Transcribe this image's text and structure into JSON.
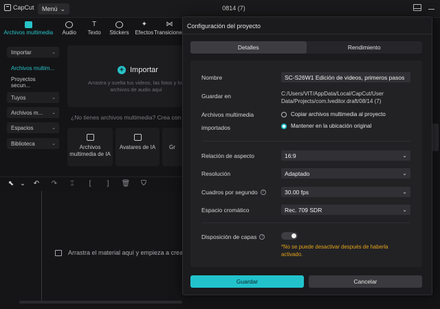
{
  "app": {
    "logo": "CapCut",
    "menu": "Menú",
    "project": "0814 (7)"
  },
  "toolbar": {
    "tabs": [
      {
        "label": "Archivos multimedia",
        "icon": "media-icon"
      },
      {
        "label": "Audio",
        "icon": "audio-icon"
      },
      {
        "label": "Texto",
        "icon": "text-icon"
      },
      {
        "label": "Stickers",
        "icon": "sticker-icon"
      },
      {
        "label": "Efectos",
        "icon": "effects-icon"
      },
      {
        "label": "Transiciones",
        "icon": "transitions-icon"
      }
    ]
  },
  "sidebar": {
    "items": [
      {
        "label": "Importar"
      },
      {
        "label": "Archivos multim..."
      },
      {
        "label": "Proyectos secun..."
      },
      {
        "label": "Tuyos"
      },
      {
        "label": "Archivos m..."
      },
      {
        "label": "Espacios"
      },
      {
        "label": "Biblioteca"
      }
    ]
  },
  "media": {
    "import_label": "Importar",
    "import_hint": "Arrastra y suelta tus videos, las fotos y los archivos de audio aquí",
    "no_media": "¿No tienes archivos multimedia? Crea con",
    "cards": [
      {
        "label": "Archivos multimedia de IA"
      },
      {
        "label": "Avatares de IA"
      },
      {
        "label": "Gr"
      }
    ]
  },
  "timeline": {
    "drop_hint": "Arrastra el material aquí y empieza a crear"
  },
  "dialog": {
    "title": "Configuración del proyecto",
    "tabs": [
      {
        "label": "Detalles",
        "active": true
      },
      {
        "label": "Rendimiento",
        "active": false
      }
    ],
    "name_label": "Nombre",
    "name_value": "SC-S26W1 Edición de videos, primeros pasos",
    "save_label": "Guardar en",
    "save_path": "C:/Users/VIT/AppData/Local/CapCut/User Data/Projects/com.lveditor.draft/08/14 (7)",
    "imported_label_1": "Archivos multimedia",
    "imported_label_2": "importados",
    "radio_copy": "Copiar archivos multimedia al proyecto",
    "radio_keep": "Mantener en la ubicación original",
    "aspect_label": "Relación de aspecto",
    "aspect_value": "16:9",
    "resolution_label": "Resolución",
    "resolution_value": "Adaptado",
    "fps_label": "Cuadros por segundo",
    "fps_value": "30.00 fps",
    "color_label": "Espacio cromático",
    "color_value": "Rec. 709 SDR",
    "layers_label": "Disposición de capas",
    "warning": "*No se puede desactivar después de haberla activado.",
    "save_button": "Guardar",
    "cancel_button": "Cancelar"
  },
  "colors": {
    "accent": "#22c2cc",
    "warning": "#e2a21b"
  }
}
